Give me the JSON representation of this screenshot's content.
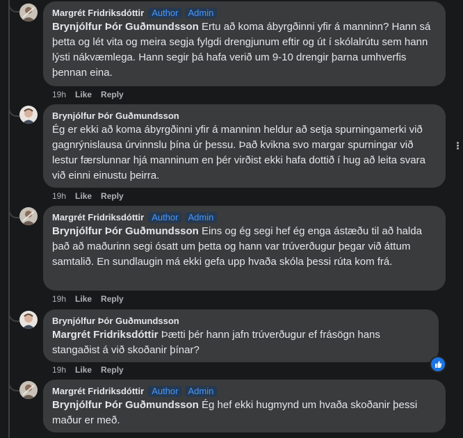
{
  "comments": [
    {
      "author": "Margrét Fridriksdóttir",
      "badges": [
        "Author",
        "Admin"
      ],
      "mention": "Brynjólfur Þór Guðmundsson",
      "text": " Ertu að koma ábyrgðinni yfir á manninn? Hann sá þetta og lét vita og meira segja fylgdi drengjunum eftir og út í skólalrútu sem hann lýsti nákvæmlega. Hann segir þá hafa verið um 9-10 drengir þarna umhverfis þennan eina.",
      "time": "19h",
      "like": "Like",
      "reply": "Reply"
    },
    {
      "author": "Brynjólfur Þór Guðmundsson",
      "badges": [],
      "mention": "",
      "text": "Ég er ekki að koma ábyrgðinni yfir á manninn heldur að setja spurningamerki við gagnrýnislausa úrvinnslu þína úr þessu. Það kvikna svo margar spurningar við lestur færslunnar hjá manninum en þér virðist ekki hafa dottið í hug að leita svara við einni einustu þeirra.",
      "time": "19h",
      "like": "Like",
      "reply": "Reply"
    },
    {
      "author": "Margrét Fridriksdóttir",
      "badges": [
        "Author",
        "Admin"
      ],
      "mention": "Brynjólfur Þór Guðmundsson",
      "text": " Eins og ég segi hef ég enga ástæðu til að halda það að maðurinn segi ósatt um þetta og hann var trúverðugur þegar við áttum samtalið. En sundlaugin má ekki gefa upp hvaða skóla þessi rúta kom frá.",
      "time": "19h",
      "like": "Like",
      "reply": "Reply"
    },
    {
      "author": "Brynjólfur Þór Guðmundsson",
      "badges": [],
      "mention": "Margrét Fridriksdóttir",
      "text": " Þætti þér hann jafn trúverðugur ef frásögn hans stangaðist á við skoðanir þínar?",
      "time": "19h",
      "like": "Like",
      "reply": "Reply"
    },
    {
      "author": "Margrét Fridriksdóttir",
      "badges": [
        "Author",
        "Admin"
      ],
      "mention": "Brynjólfur Þór Guðmundsson",
      "text": " Ég hef ekki hugmynd um hvaða skoðanir þessi maður er með.",
      "time": "",
      "like": "",
      "reply": ""
    }
  ],
  "colors": {
    "background": "#18191a",
    "bubble": "#3a3b3c",
    "badge_text": "#4599ff",
    "badge_bg": "#263951",
    "meta_text": "#b0b3b8",
    "like_blue": "#1b74e4"
  },
  "icons": {
    "reaction": "thumbs-up-icon",
    "menu": "more-options-icon"
  }
}
